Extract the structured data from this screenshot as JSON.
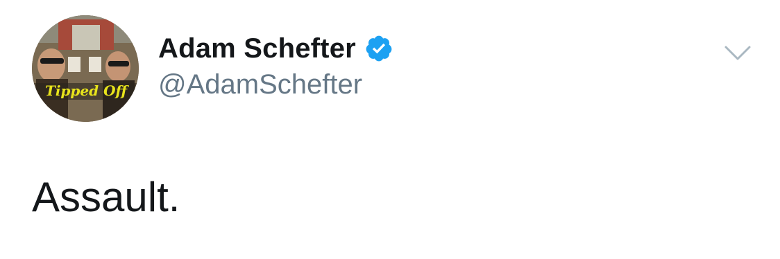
{
  "author": {
    "display_name": "Adam Schefter",
    "handle": "@AdamSchefter",
    "verified": true,
    "avatar_caption": "Tipped Off"
  },
  "tweet": {
    "text": "Assault."
  },
  "icons": {
    "verified": "verified-badge-icon",
    "menu": "chevron-down-icon"
  },
  "colors": {
    "verified_blue": "#1da1f2",
    "text_primary": "#14171a",
    "text_secondary": "#657786",
    "chevron": "#aab8c2",
    "avatar_caption": "#e8e41c"
  }
}
